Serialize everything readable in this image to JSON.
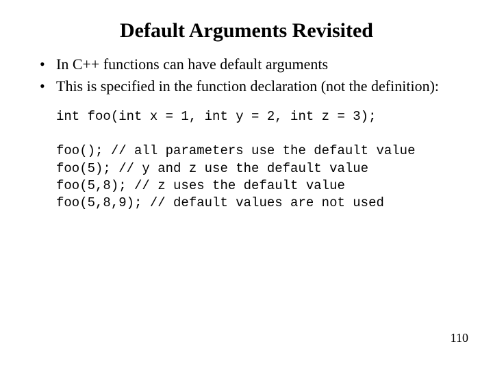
{
  "title": "Default Arguments Revisited",
  "bullets": [
    "In C++ functions can have default arguments",
    "This is specified in the function declaration (not the definition):"
  ],
  "code_lines": [
    "int foo(int x = 1, int y = 2, int z = 3);",
    "",
    "foo(); // all parameters use the default value",
    "foo(5); // y and z use the default value",
    "foo(5,8); // z uses the default value",
    "foo(5,8,9); // default values are not used"
  ],
  "page_number": "110"
}
